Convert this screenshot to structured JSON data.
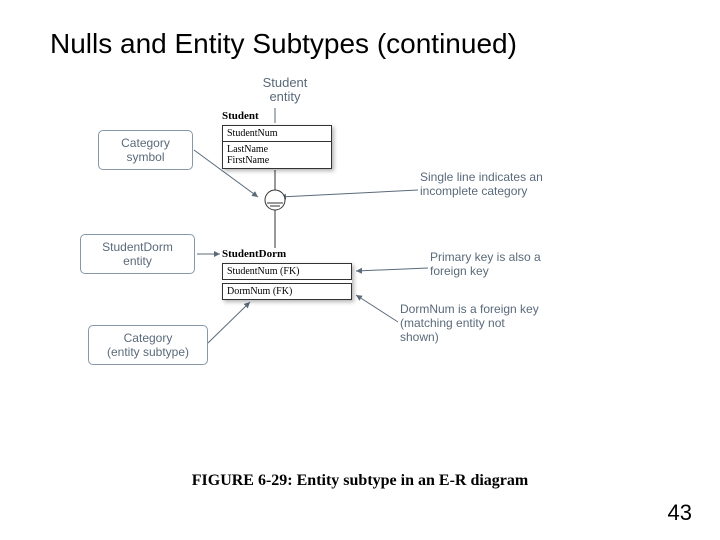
{
  "title": "Nulls and Entity Subtypes (continued)",
  "diagram": {
    "student_entity_header": "Student\nentity",
    "student_name": "Student",
    "student_pk": "StudentNum",
    "student_attr1": "LastName",
    "student_attr2": "FirstName",
    "category_symbol_label": "Category\nsymbol",
    "student_dorm_entity_label": "StudentDorm\nentity",
    "category_entity_label": "Category\n(entity subtype)",
    "student_dorm_name": "StudentDorm",
    "student_dorm_pk": "StudentNum (FK)",
    "student_dorm_fk": "DormNum (FK)",
    "single_line_note": "Single line indicates an incomplete category",
    "pk_fk_note": "Primary key is also a foreign key",
    "dormnum_note": "DormNum is a foreign key (matching entity not shown)"
  },
  "caption": "FIGURE 6-29: Entity subtype in an E-R diagram",
  "page": "43"
}
